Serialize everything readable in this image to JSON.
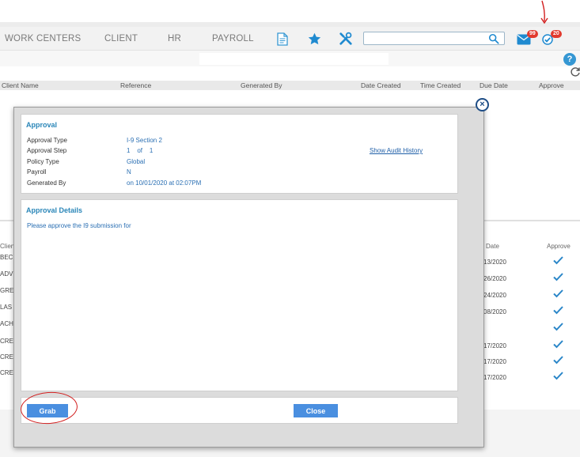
{
  "nav": {
    "items": [
      "WORK CENTERS",
      "CLIENT",
      "HR",
      "PAYROLL"
    ],
    "mail_badge": "99",
    "approvals_badge": "20"
  },
  "icons": {
    "document": "document-icon",
    "favorites": "star-icon",
    "tools": "tools-icon",
    "search": "search-icon",
    "mail": "mail-icon",
    "approvals": "check-circle-icon",
    "help": "help-icon",
    "refresh": "refresh-icon",
    "close": "close-icon",
    "check": "check-icon"
  },
  "help_glyph": "?",
  "table": {
    "headers": [
      "Client Name",
      "Reference",
      "Generated By",
      "Date Created",
      "Time Created",
      "Due Date",
      "Approve"
    ],
    "lower_headers": {
      "client": "Clien",
      "date": "Date",
      "approve": "Approve"
    },
    "rows": [
      {
        "client": "BEC",
        "date": "13/2020"
      },
      {
        "client": "ADV",
        "date": "26/2020"
      },
      {
        "client": "GRE",
        "date": "24/2020"
      },
      {
        "client": "LAS",
        "date": "08/2020"
      },
      {
        "client": "ACH",
        "date": ""
      },
      {
        "client": "CRE",
        "date": "17/2020"
      },
      {
        "client": "CRE",
        "date": "17/2020"
      },
      {
        "client": "CRE",
        "date": "17/2020"
      }
    ]
  },
  "modal": {
    "close_glyph": "×",
    "approval": {
      "title": "Approval",
      "fields": [
        {
          "label": "Approval Type",
          "value": "I-9 Section 2"
        },
        {
          "label": "Approval Step",
          "value": "1    of    1"
        },
        {
          "label": "Policy Type",
          "value": "Global"
        },
        {
          "label": "Payroll",
          "value": "N"
        },
        {
          "label": "Generated By",
          "value": "on 10/01/2020 at 02:07PM"
        }
      ],
      "audit_link": "Show Audit History"
    },
    "details": {
      "title": "Approval Details",
      "text": "Please approve the I9 submission for"
    },
    "buttons": {
      "grab": "Grab",
      "close": "Close"
    }
  },
  "colors": {
    "accent": "#2a86b8",
    "button": "#4a8fe0",
    "badge": "#e23a2e",
    "annotation": "#d21f1f"
  }
}
